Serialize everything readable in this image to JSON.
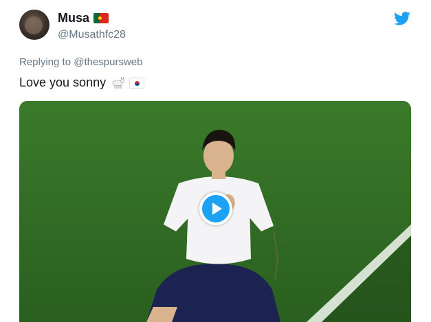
{
  "tweet": {
    "author": {
      "display_name": "Musa",
      "handle": "@Musathfc28",
      "flag_icon": "portugal-flag-icon"
    },
    "reply_prefix": "Replying to",
    "reply_to": "@thespursweb",
    "text": "Love you sonny",
    "text_emojis": [
      "goat-emoji-icon",
      "south-korea-flag-icon"
    ],
    "media": {
      "type": "gif-video",
      "play_icon": "play-icon"
    }
  },
  "colors": {
    "brand": "#1da1f2",
    "text_primary": "#14171a",
    "text_secondary": "#657786",
    "pitch_green": "#2f6b22"
  }
}
